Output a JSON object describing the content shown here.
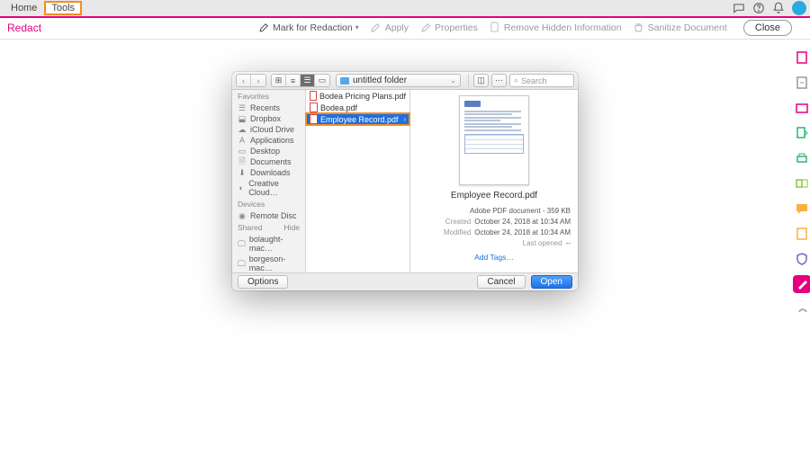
{
  "topbar": {
    "home": "Home",
    "tools": "Tools"
  },
  "redact": {
    "label": "Redact",
    "mark": "Mark for Redaction",
    "apply": "Apply",
    "properties": "Properties",
    "remove_hidden": "Remove Hidden Information",
    "sanitize": "Sanitize Document",
    "close": "Close"
  },
  "dialog": {
    "location": "untitled folder",
    "search_placeholder": "Search",
    "sidebar": {
      "favorites": "Favorites",
      "recents": "Recents",
      "dropbox": "Dropbox",
      "icloud": "iCloud Drive",
      "applications": "Applications",
      "desktop": "Desktop",
      "documents": "Documents",
      "downloads": "Downloads",
      "creative": "Creative Cloud…",
      "devices": "Devices",
      "remote_disc": "Remote Disc",
      "shared": "Shared",
      "hide": "Hide",
      "host1": "bolaught-mac…",
      "host2": "borgeson-mac…"
    },
    "files": {
      "f0": "Bodea Pricing Plans.pdf",
      "f1": "Bodea.pdf",
      "f2": "Employee Record.pdf"
    },
    "preview": {
      "title": "Employee Record.pdf",
      "kind": "Adobe PDF document - 359 KB",
      "created_lbl": "Created",
      "created_val": "October 24, 2018 at 10:34 AM",
      "modified_lbl": "Modified",
      "modified_val": "October 24, 2018 at 10:34 AM",
      "lastopened_lbl": "Last opened",
      "lastopened_val": "--",
      "add_tags": "Add Tags…"
    },
    "footer": {
      "options": "Options",
      "cancel": "Cancel",
      "open": "Open"
    }
  }
}
